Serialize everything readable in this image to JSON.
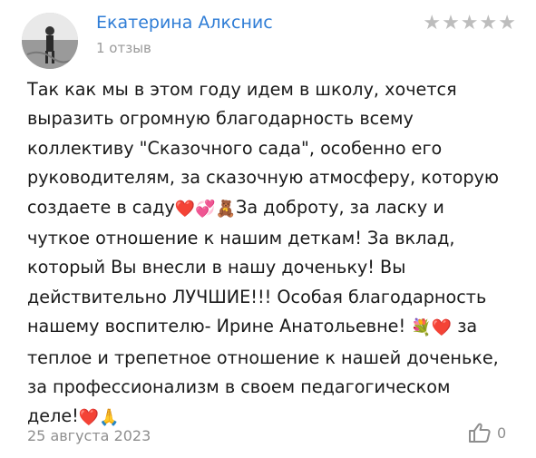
{
  "review": {
    "author_name": "Екатерина Алкснис",
    "review_count": "1 отзыв",
    "rating": 5,
    "rating_stars": [
      "★",
      "★",
      "★",
      "★",
      "★"
    ],
    "lines": [
      [
        "Так как мы в этом году идем в школу, хочется"
      ],
      [
        "выразить огромную благодарность всему"
      ],
      [
        "коллективу \"Сказочного сада\", особенно его"
      ],
      [
        "руководителям, за сказочную атмосферу, которую"
      ],
      [
        "создаете в саду",
        "❤️",
        "💞",
        "🧸",
        "За доброту, за ласку и"
      ],
      [
        "чуткое отношение к нашим деткам! За вклад,"
      ],
      [
        "который Вы внесли в нашу доченьку! Вы"
      ],
      [
        "действительно ЛУЧШИЕ!!! Особая благодарность"
      ],
      [
        "нашему воспителю- Ирине Анатольевне! ",
        "💐",
        "❤️",
        " за"
      ],
      [
        "теплое и трепетное отношение к нашей доченьке,"
      ],
      [
        "за профессионализм в своем педагогическом"
      ],
      [
        "деле!",
        "❤️",
        "🙏"
      ]
    ],
    "date": "25 августа 2023",
    "like_count": "0"
  },
  "icons": {
    "avatar": "avatar-photo-icon",
    "like": "thumbs-up-icon",
    "star": "star-icon"
  },
  "colors": {
    "author_link": "#2f7dd6",
    "muted_text": "#8e8e8e",
    "star_inactive": "#bdbdbd"
  }
}
